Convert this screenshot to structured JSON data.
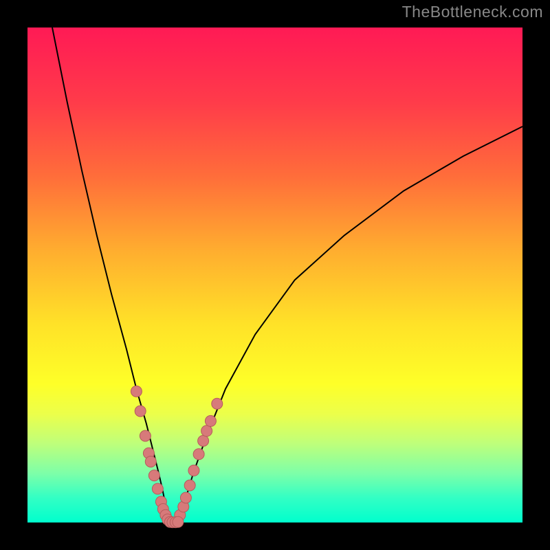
{
  "watermark": "TheBottleneck.com",
  "chart_data": {
    "type": "line",
    "title": "",
    "xlabel": "",
    "ylabel": "",
    "xlim": [
      0,
      100
    ],
    "ylim": [
      0,
      100
    ],
    "curve_left": {
      "x": [
        5,
        8,
        11,
        14,
        17,
        20,
        22,
        24,
        25.5,
        26.5,
        27.3,
        27.9,
        28.4,
        28.7
      ],
      "y": [
        100,
        85,
        71,
        58,
        46,
        35,
        27,
        20,
        14,
        10,
        6.5,
        3.5,
        1.5,
        0.3
      ]
    },
    "curve_right": {
      "x": [
        30.3,
        31,
        32,
        33.5,
        36,
        40,
        46,
        54,
        64,
        76,
        88,
        100
      ],
      "y": [
        0.3,
        2,
        5,
        10,
        17,
        27,
        38,
        49,
        58,
        67,
        74,
        80
      ]
    },
    "markers_left": {
      "x": [
        22.0,
        22.8,
        23.8,
        24.5,
        24.9,
        25.6,
        26.3,
        27.0,
        27.4,
        27.9,
        28.3
      ],
      "y": [
        26.5,
        22.5,
        17.5,
        14.0,
        12.3,
        9.5,
        6.8,
        4.2,
        2.7,
        1.5,
        0.6
      ]
    },
    "markers_right": {
      "x": [
        30.8,
        31.5,
        32.0,
        32.8,
        33.6,
        34.6,
        35.5,
        36.2,
        37.0,
        38.3
      ],
      "y": [
        1.5,
        3.2,
        5.0,
        7.5,
        10.5,
        13.8,
        16.5,
        18.5,
        20.5,
        24.0
      ]
    },
    "markers_bottom": {
      "x": [
        28.8,
        29.3,
        29.9,
        30.4
      ],
      "y": [
        0.1,
        0.05,
        0.05,
        0.1
      ]
    },
    "colors": {
      "curve": "#000000",
      "marker_fill": "#d77a7a",
      "marker_stroke": "#b55b5b"
    }
  }
}
